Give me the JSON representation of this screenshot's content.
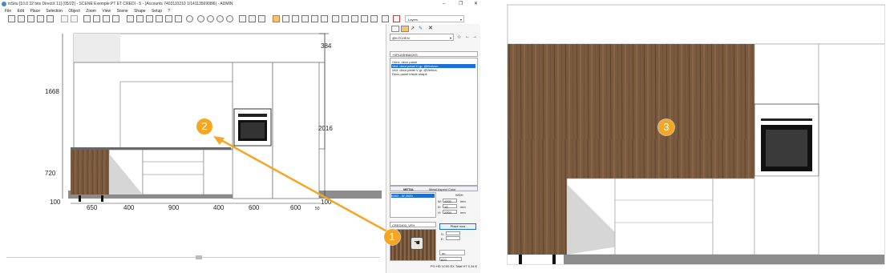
{
  "window": {
    "title": "inSitu [10.0 32 bits DirectX 11] (05/22) - SCENE Exemple PT ET CREDI - 5 - (Accounts 7403110210 1/1411356908l6) - ADMIN",
    "min": "–",
    "max": "❐",
    "close": "✕"
  },
  "menu": [
    "File",
    "Edit",
    "Place",
    "Selection",
    "Object",
    "Zoom",
    "View",
    "Scene",
    "Shape",
    "Setup",
    "?"
  ],
  "layers_label": "Layers",
  "dimensions": {
    "top": "384",
    "left_upper": "1668",
    "right": "2016",
    "left_mid": "720",
    "left_low": "100",
    "bottom_right": "100",
    "bottom_edge": "50",
    "widths": [
      "650",
      "400",
      "900",
      "400",
      "600",
      "600"
    ]
  },
  "panel": {
    "category": "@KITCHEN",
    "subcategory": "+SPLASHBACKS",
    "items": [
      "Horiz. deco panel",
      "Vert. deco panel H gr. @Horizon",
      "Vert. deco panel V gr. @Vertica",
      "Deco panel inside shape"
    ],
    "selected_index": 1,
    "material_tab": "METAL",
    "material_label": "Metal Aspect Color",
    "finish_code": "K002 - W 2000",
    "wdh_label": "WDH",
    "w_label": "W:",
    "w_value": "4000",
    "d_label": "D:",
    "d_value": "10",
    "h_label": "H:",
    "h_value": "2000",
    "unit": "mm",
    "model_code": "CRED400_VFH",
    "place_now": "Place now",
    "sf_label": "S:",
    "sf2_label": "E:",
    "on_label": "on",
    "bottom_value": "820",
    "footer": "PO HD 1C00 EX Total HT 0,34 €"
  },
  "badges": {
    "one": "1",
    "two": "2",
    "three": "3"
  },
  "colors": {
    "accent": "#f5a623",
    "selection": "#1c6fd6",
    "wood": "#7a5a3e"
  }
}
